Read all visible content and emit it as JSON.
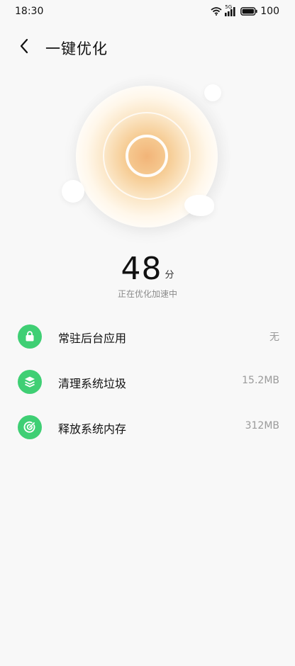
{
  "status_bar": {
    "time": "18:30",
    "network": "5G",
    "battery": "100"
  },
  "header": {
    "title": "一键优化"
  },
  "score": {
    "value": "48",
    "unit": "分",
    "status": "正在优化加速中"
  },
  "items": [
    {
      "label": "常驻后台应用",
      "value": "无",
      "icon": "lock-icon"
    },
    {
      "label": "清理系统垃圾",
      "value": "15.2MB",
      "icon": "layers-icon"
    },
    {
      "label": "释放系统内存",
      "value": "312MB",
      "icon": "target-icon"
    }
  ],
  "colors": {
    "accent_green": "#3fcf74",
    "orb_orange": "#f2b478",
    "background": "#f8f8f8"
  }
}
